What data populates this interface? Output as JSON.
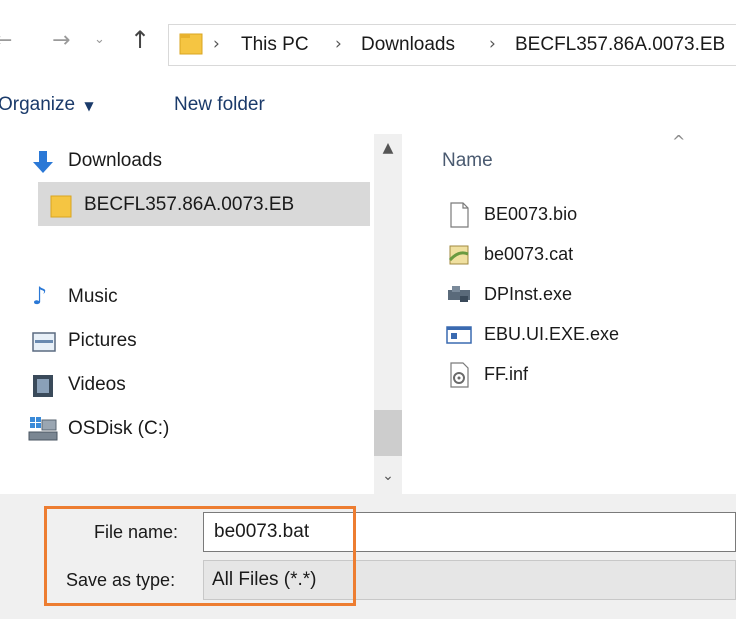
{
  "address_bar": {
    "breadcrumbs": [
      "This PC",
      "Downloads",
      "BECFL357.86A.0073.EB"
    ]
  },
  "toolbar": {
    "organize_label": "Organize",
    "new_folder_label": "New folder"
  },
  "nav_pane": {
    "items": [
      {
        "label": "Downloads",
        "icon": "download-arrow-icon"
      },
      {
        "label": "BECFL357.86A.0073.EB",
        "icon": "folder-icon",
        "selected": true
      },
      {
        "label": "Music",
        "icon": "music-note-icon"
      },
      {
        "label": "Pictures",
        "icon": "pictures-icon"
      },
      {
        "label": "Videos",
        "icon": "videos-icon"
      },
      {
        "label": "OSDisk (C:)",
        "icon": "drive-icon"
      }
    ]
  },
  "file_pane": {
    "column_name": "Name",
    "files": [
      {
        "name": "BE0073.bio",
        "icon": "blank-file-icon"
      },
      {
        "name": "be0073.cat",
        "icon": "security-catalog-icon"
      },
      {
        "name": "DPInst.exe",
        "icon": "installer-icon"
      },
      {
        "name": "EBU.UI.EXE.exe",
        "icon": "app-window-icon"
      },
      {
        "name": "FF.inf",
        "icon": "settings-file-icon"
      }
    ]
  },
  "save_area": {
    "file_name_label": "File name:",
    "file_name_value": "be0073.bat",
    "save_type_label": "Save as type:",
    "save_type_value": "All Files  (*.*)"
  },
  "colors": {
    "highlight": "#ed7d31",
    "folder": "#f5c542",
    "download_arrow": "#2a78d6",
    "music_note": "#2a78d6"
  }
}
